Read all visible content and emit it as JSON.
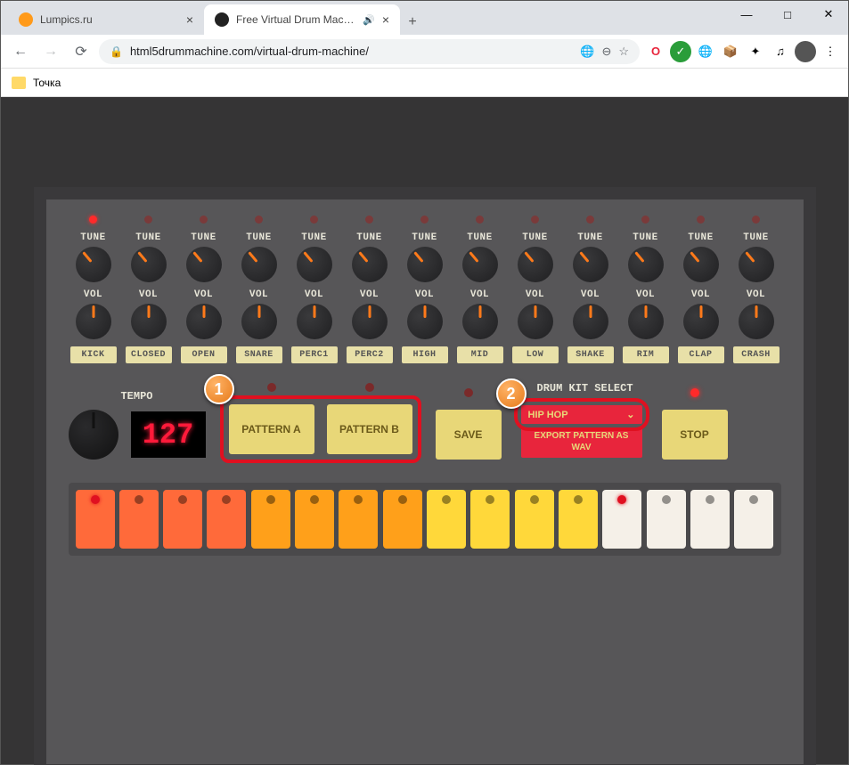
{
  "window": {
    "tabs": [
      {
        "title": "Lumpics.ru",
        "active": false
      },
      {
        "title": "Free Virtual Drum Machine, U",
        "active": true,
        "audio": true
      }
    ],
    "url_display": "html5drummachine.com/virtual-drum-machine/"
  },
  "bookmarks_bar": {
    "item1": "Точка"
  },
  "drum_machine": {
    "knob_labels": {
      "tune": "TUNE",
      "vol": "VOL"
    },
    "channels": [
      {
        "name": "KICK",
        "led_on": true
      },
      {
        "name": "CLOSED",
        "led_on": false
      },
      {
        "name": "OPEN",
        "led_on": false
      },
      {
        "name": "SNARE",
        "led_on": false
      },
      {
        "name": "PERC1",
        "led_on": false
      },
      {
        "name": "PERC2",
        "led_on": false
      },
      {
        "name": "HIGH",
        "led_on": false
      },
      {
        "name": "MID",
        "led_on": false
      },
      {
        "name": "LOW",
        "led_on": false
      },
      {
        "name": "SHAKE",
        "led_on": false
      },
      {
        "name": "RIM",
        "led_on": false
      },
      {
        "name": "CLAP",
        "led_on": false
      },
      {
        "name": "CRASH",
        "led_on": false
      }
    ],
    "tempo": {
      "label": "TEMPO",
      "value": "127"
    },
    "transport": {
      "pattern_a": "PATTERN A",
      "pattern_b": "PATTERN B",
      "save": "SAVE",
      "stop": "STOP"
    },
    "kit": {
      "label": "DRUM KIT SELECT",
      "selected": "HIP HOP",
      "export_label": "EXPORT PATTERN AS WAV"
    },
    "pads": [
      {
        "c": "red",
        "lit": true
      },
      {
        "c": "red",
        "lit": false
      },
      {
        "c": "red",
        "lit": false
      },
      {
        "c": "red",
        "lit": false
      },
      {
        "c": "orange",
        "lit": false
      },
      {
        "c": "orange",
        "lit": false
      },
      {
        "c": "orange",
        "lit": false
      },
      {
        "c": "orange",
        "lit": false
      },
      {
        "c": "yellow",
        "lit": false
      },
      {
        "c": "yellow",
        "lit": false
      },
      {
        "c": "yellow",
        "lit": false
      },
      {
        "c": "yellow",
        "lit": false
      },
      {
        "c": "white",
        "lit": true
      },
      {
        "c": "white",
        "lit": false
      },
      {
        "c": "white",
        "lit": false
      },
      {
        "c": "white",
        "lit": false
      }
    ]
  },
  "annotations": {
    "badge1": "1",
    "badge2": "2"
  }
}
